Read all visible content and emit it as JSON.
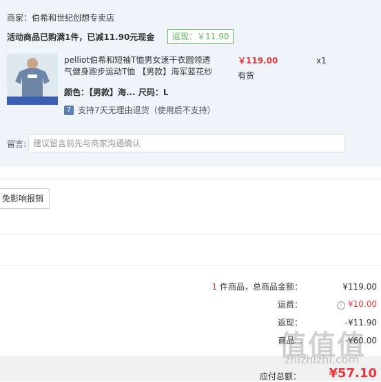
{
  "merchant": {
    "label": "商家：伯希和世纪创想专卖店"
  },
  "promo": {
    "text": "活动商品已购满1件，已减11.90元现金",
    "rebate_badge": "返现：￥11.90"
  },
  "product": {
    "title": "pelliot伯希和短袖T恤男女速干衣圆领透气健身跑步运动T恤 【男款】海军蓝花纱",
    "price": "￥119.00",
    "stock": "有货",
    "quantity": "x1",
    "specs": "颜色：【男款】海... 尺码：L",
    "return_policy": "支持7天无理由退货（使用后不支持）"
  },
  "message": {
    "label": "留言:",
    "placeholder": "建议留言前先与商家沟通确认"
  },
  "report_button": {
    "label": "免影响报销"
  },
  "summary": {
    "count": "1",
    "count_label": "件商品，总商品金额：",
    "items_total": "¥119.00",
    "shipping_label": "运费：",
    "shipping_value": "¥10.00",
    "rebate_label": "返现：",
    "rebate_value": "-¥11.90",
    "product_discount_label": "商品...",
    "product_discount_value": "-¥60.00",
    "payable_label": "应付总额：",
    "payable_value": "¥57.10"
  },
  "watermark": {
    "text": "值值值",
    "sub": "zhizhizhi.com"
  },
  "colors": {
    "accent_red": "#e4393c",
    "badge_green": "#5cb85c",
    "panel_bg": "#eef4fa"
  }
}
